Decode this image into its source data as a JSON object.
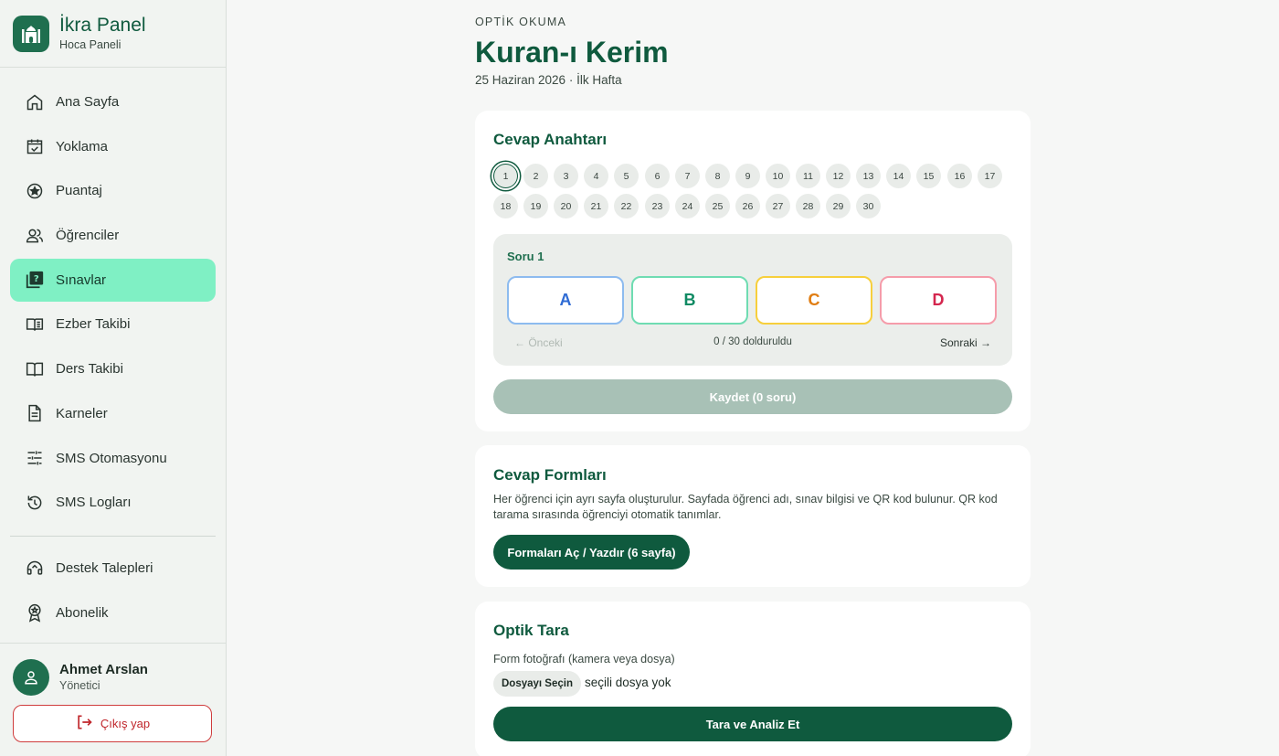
{
  "brand": {
    "title": "İkra Panel",
    "subtitle": "Hoca Paneli"
  },
  "nav": [
    {
      "label": "Ana Sayfa",
      "icon": "home-icon"
    },
    {
      "label": "Yoklama",
      "icon": "calendar-check-icon"
    },
    {
      "label": "Puantaj",
      "icon": "star-circle-icon"
    },
    {
      "label": "Öğrenciler",
      "icon": "users-icon"
    },
    {
      "label": "Sınavlar",
      "icon": "quiz-icon",
      "active": true
    },
    {
      "label": "Ezber Takibi",
      "icon": "book-icon"
    },
    {
      "label": "Ders Takibi",
      "icon": "open-book-icon"
    },
    {
      "label": "Karneler",
      "icon": "document-icon"
    },
    {
      "label": "SMS Otomasyonu",
      "icon": "sliders-icon"
    },
    {
      "label": "SMS Logları",
      "icon": "history-icon"
    }
  ],
  "nav_secondary": [
    {
      "label": "Destek Talepleri",
      "icon": "headset-icon"
    },
    {
      "label": "Abonelik",
      "icon": "badge-icon"
    }
  ],
  "user": {
    "name": "Ahmet Arslan",
    "role": "Yönetici",
    "logout_label": "Çıkış yap"
  },
  "header": {
    "eyebrow": "OPTİK OKUMA",
    "title": "Kuran-ı Kerim",
    "subtitle": "25 Haziran 2026 · İlk Hafta"
  },
  "answer_key": {
    "title": "Cevap Anahtarı",
    "questions": [
      "1",
      "2",
      "3",
      "4",
      "5",
      "6",
      "7",
      "8",
      "9",
      "10",
      "11",
      "12",
      "13",
      "14",
      "15",
      "16",
      "17",
      "18",
      "19",
      "20",
      "21",
      "22",
      "23",
      "24",
      "25",
      "26",
      "27",
      "28",
      "29",
      "30"
    ],
    "active_question": "1",
    "current_label": "Soru 1",
    "options": [
      "A",
      "B",
      "C",
      "D"
    ],
    "prev_label": "← Önceki",
    "progress_label": "0 / 30 dolduruldu",
    "next_label": "Sonraki →",
    "save_label": "Kaydet (0 soru)"
  },
  "forms": {
    "title": "Cevap Formları",
    "description": "Her öğrenci için ayrı sayfa oluşturulur. Sayfada öğrenci adı, sınav bilgisi ve QR kod bulunur. QR kod tarama sırasında öğrenciyi otomatik tanımlar.",
    "button_label": "Formaları Aç / Yazdır (6 sayfa)"
  },
  "scan": {
    "title": "Optik Tara",
    "file_label": "Form fotoğrafı (kamera veya dosya)",
    "file_button": "Dosyayı Seçin",
    "file_status": "seçili dosya yok",
    "button_label": "Tara ve Analiz Et"
  },
  "colors": {
    "primary": "#0f5a3e",
    "active_nav": "#7ff0c4",
    "logout": "#c0262b"
  }
}
